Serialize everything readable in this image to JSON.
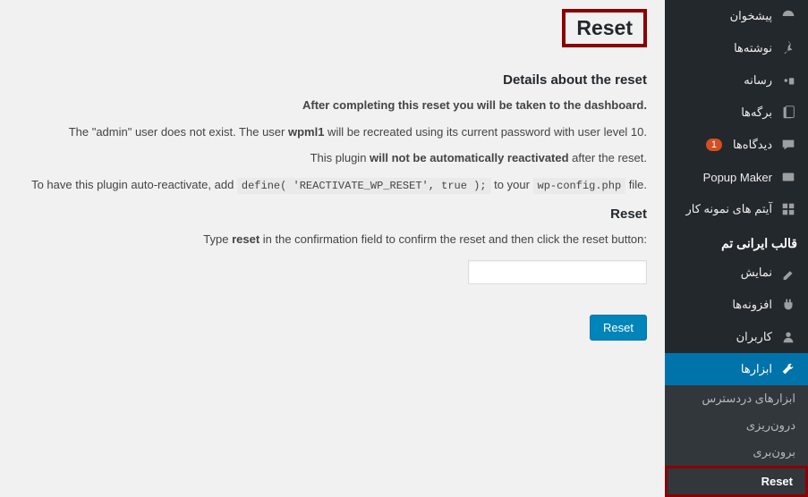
{
  "sidebar": {
    "items": [
      {
        "label": "پیشخوان",
        "icon": "dashboard"
      },
      {
        "label": "نوشته‌ها",
        "icon": "pin"
      },
      {
        "label": "رسانه",
        "icon": "media"
      },
      {
        "label": "برگه‌ها",
        "icon": "page"
      },
      {
        "label": "دیدگاه‌ها",
        "icon": "comment",
        "badge": "1"
      },
      {
        "label": "Popup Maker",
        "icon": "popup"
      },
      {
        "label": "آیتم های نمونه کار",
        "icon": "portfolio"
      }
    ],
    "section_heading": "قالب ایرانی تم",
    "section_items": [
      {
        "label": "نمایش",
        "icon": "appearance"
      },
      {
        "label": "افزونه‌ها",
        "icon": "plugin"
      },
      {
        "label": "کاربران",
        "icon": "users"
      },
      {
        "label": "ابزارها",
        "icon": "tools",
        "active": true
      }
    ],
    "submenu": [
      {
        "label": "ابزارهای دردسترس"
      },
      {
        "label": "درون‌ریزی"
      },
      {
        "label": "برون‌بری"
      },
      {
        "label": "Reset",
        "highlight": true
      }
    ]
  },
  "content": {
    "page_title": "Reset",
    "details_heading": "Details about the reset",
    "line1": "After completing this reset you will be taken to the dashboard.",
    "line2_prefix": "The \"admin\" user does not exist. The user ",
    "line2_bold": "wpml1",
    "line2_suffix": " will be recreated using its current password with user level 10.",
    "line3_prefix": "This plugin ",
    "line3_bold": "will not be automatically reactivated",
    "line3_suffix": " after the reset.",
    "line4_prefix": "To have this plugin auto-reactivate, add ",
    "line4_code": "define( 'REACTIVATE_WP_RESET', true );",
    "line4_mid": " to your ",
    "line4_code2": "wp-config.php",
    "line4_suffix": " file.",
    "reset_heading": "Reset",
    "confirm_text_pre": "Type ",
    "confirm_text_bold": "reset",
    "confirm_text_post": " in the confirmation field to confirm the reset and then click the reset button:",
    "button_label": "Reset"
  }
}
